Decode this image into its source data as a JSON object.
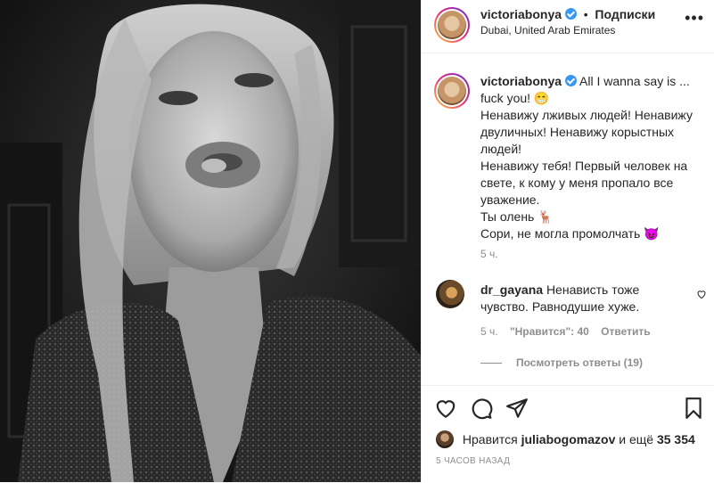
{
  "post": {
    "author": "victoriabonya",
    "follow_label": "Подписки",
    "location": "Dubai, United Arab Emirates",
    "more_label": "•••"
  },
  "caption": {
    "author": "victoriabonya",
    "lines": [
      "All I wanna say is ... fuck you! 😁",
      "Ненавижу лживых людей! Ненавижу двуличных! Ненавижу корыстных людей!",
      "Ненавижу тебя! Первый человек на свете, к кому у меня пропало все уважение.",
      "Ты олень 🦌",
      "Сори, не могла промолчать 😈"
    ],
    "time": "5 ч."
  },
  "comment": {
    "author": "dr_gayana",
    "text": "Ненависть тоже чувство. Равнодушие хуже.",
    "time": "5 ч.",
    "likes": "\"Нравится\": 40",
    "reply_label": "Ответить",
    "view_replies": "Посмотреть ответы (19)"
  },
  "likes": {
    "prefix": "Нравится",
    "user": "juliabogomazov",
    "connector": "и ещё",
    "count": "35 354"
  },
  "posted_ago": "5 ЧАСОВ НАЗАД",
  "colors": {
    "verified": "#3897f0",
    "muted": "#8e8e8e",
    "text": "#262626"
  }
}
